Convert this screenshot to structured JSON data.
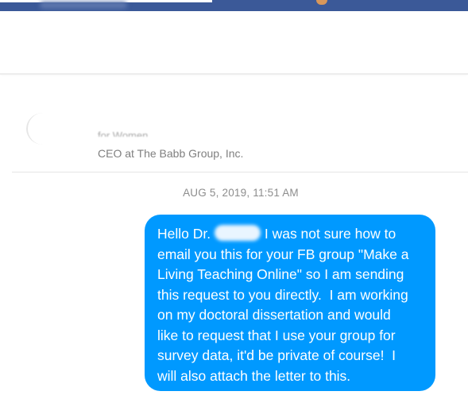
{
  "profile": {
    "faded_line": "for Women",
    "subtitle": "CEO at The Babb Group, Inc."
  },
  "conversation": {
    "timestamp": "AUG 5, 2019, 11:51 AM",
    "message": {
      "greeting": "Hello Dr.",
      "line1_rest": " I was not sure how to",
      "lines": [
        "email you this for your FB group \"Make a",
        "Living Teaching Online\" so I am sending",
        "this request to you directly.  I am working",
        "on my doctoral dissertation and would",
        "like to request that I use your group for",
        "survey data, it'd be private of course!  I",
        "will also attach the letter to this."
      ]
    }
  },
  "colors": {
    "topbar": "#3b5998",
    "bubble": "#0099ff",
    "timestamp": "#8d8d8d"
  }
}
